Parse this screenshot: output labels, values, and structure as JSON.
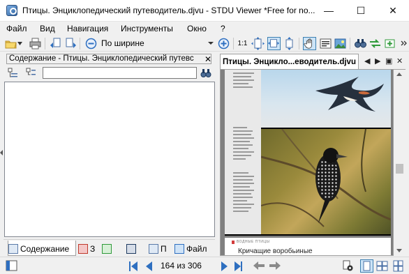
{
  "window": {
    "title": "Птицы. Энциклопедический путеводитель.djvu - STDU Viewer *Free for no...",
    "minimize": "—",
    "maximize": "☐",
    "close": "✕"
  },
  "menu": {
    "file": "Файл",
    "view": "Вид",
    "navigation": "Навигация",
    "tools": "Инструменты",
    "window": "Окно",
    "help": "?"
  },
  "toolbar": {
    "zoom_mode": "По ширине",
    "scale_label": "1:1"
  },
  "left_panel": {
    "header": "Содержание - Птицы. Энциклопедический путевс",
    "search_value": "",
    "tabs": {
      "contents": "Содержание",
      "bookmarks": "З",
      "thumbnails": "",
      "search": "",
      "pages": "П",
      "files": "Файл"
    }
  },
  "document": {
    "tab_title": "Птицы. Энцикло...еводитель.djvu",
    "caption": "Кричащие воробьиные",
    "header_note": "ВОДНЫЕ ПТИЦЫ"
  },
  "status": {
    "current_page": "164",
    "total_pages": "306",
    "page_of": "164 из 306"
  },
  "colors": {
    "accent": "#2e6fc0",
    "active_button": "#cce4f7",
    "viewer_background": "#808080"
  }
}
